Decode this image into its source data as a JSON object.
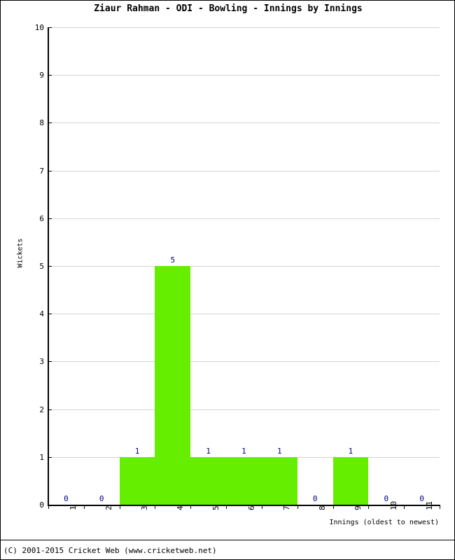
{
  "chart_data": {
    "type": "bar",
    "title": "Ziaur Rahman - ODI - Bowling - Innings by Innings",
    "xlabel": "Innings (oldest to newest)",
    "ylabel": "Wickets",
    "categories": [
      "1",
      "2",
      "3",
      "4",
      "5",
      "6",
      "7",
      "8",
      "9",
      "10",
      "11"
    ],
    "values": [
      0,
      0,
      1,
      5,
      1,
      1,
      1,
      0,
      1,
      0,
      0
    ],
    "data_labels": [
      "0",
      "0",
      "1",
      "5",
      "1",
      "1",
      "1",
      "0",
      "1",
      "0",
      "0"
    ],
    "ylim": [
      0,
      10
    ],
    "y_ticks": [
      "0",
      "1",
      "2",
      "3",
      "4",
      "5",
      "6",
      "7",
      "8",
      "9",
      "10"
    ],
    "grid": true,
    "legend": false,
    "bar_color": "#66EE00",
    "label_color": "#000080",
    "gridline_color": "#D3D3D3",
    "axis_color": "#000000"
  },
  "footer": {
    "copyright": "(C) 2001-2015 Cricket Web (www.cricketweb.net)"
  }
}
